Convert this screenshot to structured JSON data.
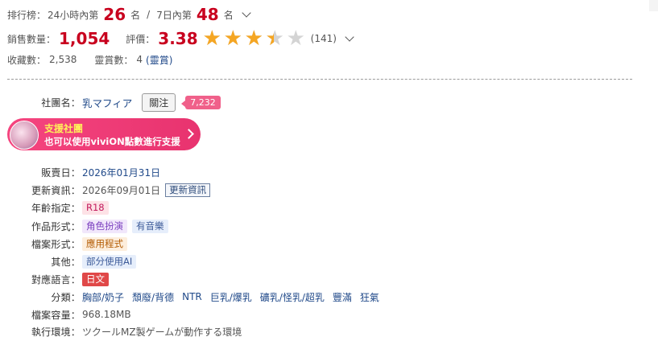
{
  "ranking": {
    "label": "排行榜：",
    "p24_prefix": "24小時內第",
    "p24_value": "26",
    "p24_suffix": "名",
    "sep": "/",
    "p7_prefix": "7日內第",
    "p7_value": "48",
    "p7_suffix": "名"
  },
  "sales": {
    "label": "銷售數量：",
    "value": "1,054",
    "rating_label": "評價：",
    "rating_value": "3.38",
    "rating_score": 3.38,
    "rating_max": 5,
    "rating_count": "(141)"
  },
  "fav": {
    "label": "收藏數：",
    "value": "2,538",
    "award_label": "靈賞數：",
    "award_value": "4",
    "award_link": "(靈賞)"
  },
  "circle": {
    "label": "社團名：",
    "name": "乳マフィア",
    "follow": "關注",
    "followers": "7,232"
  },
  "support": {
    "title": "支援社團",
    "subtitle": "也可以使用viviON點數進行支援"
  },
  "info": {
    "release_label": "販賣日：",
    "release_value": "2026年01月31日",
    "update_label": "更新資訊：",
    "update_value": "2026年09月01日",
    "update_button": "更新資訊",
    "age_label": "年齡指定：",
    "age_value": "R18",
    "format_label": "作品形式：",
    "format_values": [
      "角色扮演",
      "有音樂"
    ],
    "file_label": "檔案形式：",
    "file_value": "應用程式",
    "other_label": "其他：",
    "other_value": "部分使用AI",
    "lang_label": "對應語言：",
    "lang_value": "日文",
    "genre_label": "分類：",
    "genres": [
      "胸部/奶子",
      "頹廢/背德",
      "NTR",
      "巨乳/爆乳",
      "礦乳/怪乳/超乳",
      "豐滿",
      "狂氣"
    ],
    "size_label": "檔案容量：",
    "size_value": "968.18MB",
    "env_label": "執行環境：",
    "env_value": "ツクールMZ製ゲームが動作する環境"
  },
  "colors": {
    "accent_red": "#c8001e",
    "star": "#f5a623",
    "badge_pink": "#f0608a",
    "support_pink": "#e8336f"
  }
}
